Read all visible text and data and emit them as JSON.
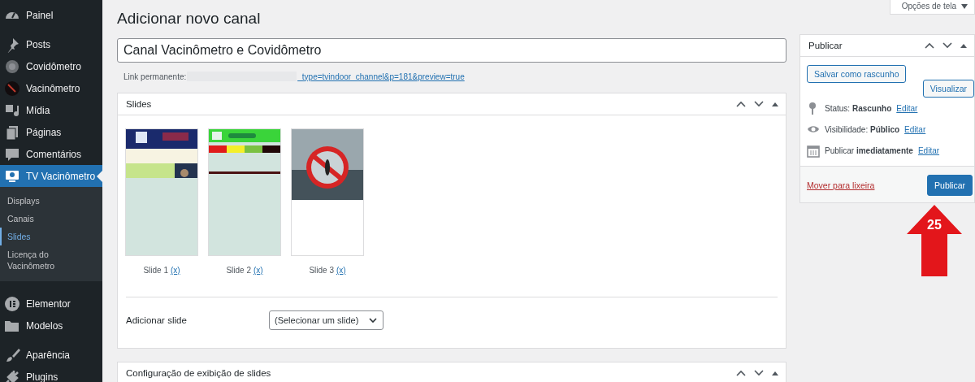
{
  "sidebar": {
    "items": [
      {
        "label": "Painel",
        "selected": false
      },
      {
        "label": "Posts",
        "selected": false
      },
      {
        "label": "Covidômetro",
        "selected": false
      },
      {
        "label": "Vacinômetro",
        "selected": false
      },
      {
        "label": "Mídia",
        "selected": false
      },
      {
        "label": "Páginas",
        "selected": false
      },
      {
        "label": "Comentários",
        "selected": false
      },
      {
        "label": "TV Vacinômetro",
        "selected": true,
        "children": [
          {
            "label": "Displays",
            "selected": false
          },
          {
            "label": "Canais",
            "selected": false
          },
          {
            "label": "Slides",
            "selected": true
          },
          {
            "label": "Licença do Vacinômetro",
            "selected": false
          }
        ]
      },
      {
        "label": "Elementor",
        "selected": false
      },
      {
        "label": "Modelos",
        "selected": false
      },
      {
        "label": "Aparência",
        "selected": false
      },
      {
        "label": "Plugins",
        "selected": false
      }
    ]
  },
  "screen_options": "Opções de tela",
  "page_title": "Adicionar novo canal",
  "title_field": {
    "value": "Canal Vacinômetro e Covidômetro"
  },
  "permalink": {
    "label": "Link permanente:",
    "link": "_type=tvindoor_channel&p=181&preview=true"
  },
  "slides_panel": {
    "title": "Slides",
    "slides": [
      {
        "caption": "Slide 1",
        "remove": "(x)",
        "kind": "picture"
      },
      {
        "caption": "Slide 2",
        "remove": "(x)",
        "kind": "picture"
      },
      {
        "caption": "Slide 3",
        "remove": "(x)",
        "kind": "picture"
      }
    ],
    "add_label": "Adicionar slide",
    "select": {
      "value": "(Selecionar um slide)"
    }
  },
  "publish_box": {
    "title": "Publicar",
    "save_draft": "Salvar como rascunho",
    "preview": "Visualizar",
    "rows": [
      {
        "text": "Status: **Rascunho**",
        "link": "Editar"
      },
      {
        "text": "Visibilidade: **Público**",
        "link": "Editar"
      },
      {
        "text": "Publicar **imediatamente**",
        "link": "Editar"
      }
    ],
    "trash": "Mover para lixeira",
    "publish": "Publicar"
  },
  "annotation": {
    "label": "25"
  },
  "next_panel": {
    "title": "Configuração de exibição de slides"
  }
}
